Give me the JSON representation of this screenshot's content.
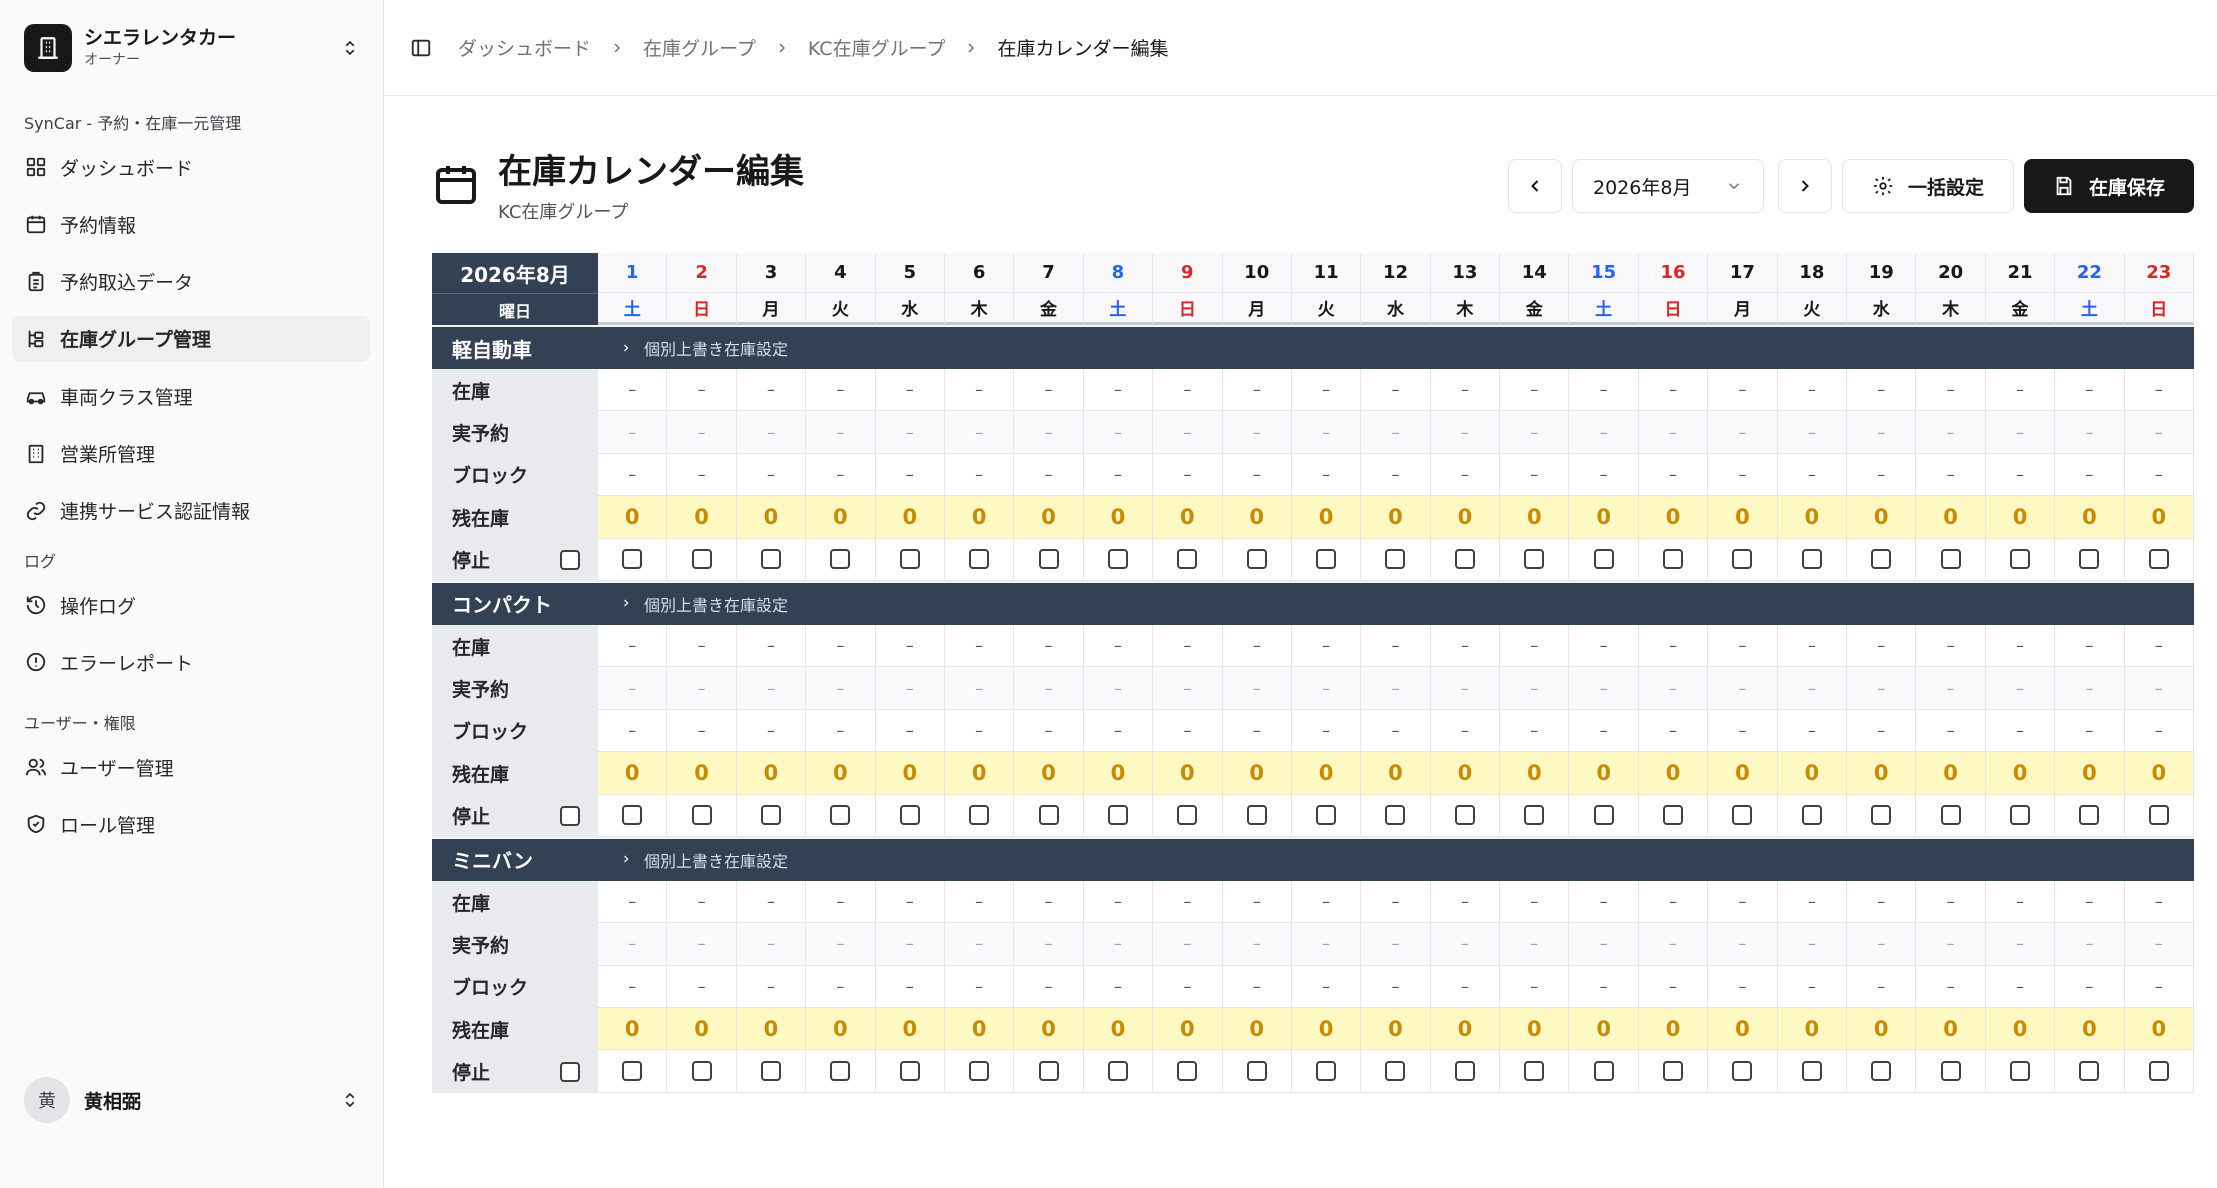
{
  "sidebar": {
    "org_name": "シエラレンタカー",
    "org_role": "オーナー",
    "section1": "SynCar - 予約・在庫一元管理",
    "items1": [
      {
        "label": "ダッシュボード",
        "icon": "grid-icon"
      },
      {
        "label": "予約情報",
        "icon": "calendar-icon"
      },
      {
        "label": "予約取込データ",
        "icon": "clipboard-icon"
      },
      {
        "label": "在庫グループ管理",
        "icon": "tree-icon",
        "active": true
      },
      {
        "label": "車両クラス管理",
        "icon": "car-icon"
      },
      {
        "label": "営業所管理",
        "icon": "building-icon"
      },
      {
        "label": "連携サービス認証情報",
        "icon": "link-icon"
      }
    ],
    "section2": "ログ",
    "items2": [
      {
        "label": "操作ログ",
        "icon": "history-icon"
      },
      {
        "label": "エラーレポート",
        "icon": "alert-icon"
      }
    ],
    "section3": "ユーザー・権限",
    "items3": [
      {
        "label": "ユーザー管理",
        "icon": "users-icon"
      },
      {
        "label": "ロール管理",
        "icon": "shield-icon"
      }
    ],
    "user_avatar": "黄",
    "user_name": "黄相弼"
  },
  "breadcrumb": [
    "ダッシュボード",
    "在庫グループ",
    "KC在庫グループ",
    "在庫カレンダー編集"
  ],
  "page": {
    "title": "在庫カレンダー編集",
    "subtitle": "KC在庫グループ",
    "month": "2026年8月",
    "bulk_label": "一括設定",
    "save_label": "在庫保存"
  },
  "calendar": {
    "month_label": "2026年8月",
    "weekday_label": "曜日",
    "days": [
      {
        "d": "1",
        "w": "土",
        "t": "sat"
      },
      {
        "d": "2",
        "w": "日",
        "t": "sun"
      },
      {
        "d": "3",
        "w": "月"
      },
      {
        "d": "4",
        "w": "火"
      },
      {
        "d": "5",
        "w": "水"
      },
      {
        "d": "6",
        "w": "木"
      },
      {
        "d": "7",
        "w": "金"
      },
      {
        "d": "8",
        "w": "土",
        "t": "sat"
      },
      {
        "d": "9",
        "w": "日",
        "t": "sun"
      },
      {
        "d": "10",
        "w": "月"
      },
      {
        "d": "11",
        "w": "火"
      },
      {
        "d": "12",
        "w": "水"
      },
      {
        "d": "13",
        "w": "木"
      },
      {
        "d": "14",
        "w": "金"
      },
      {
        "d": "15",
        "w": "土",
        "t": "sat"
      },
      {
        "d": "16",
        "w": "日",
        "t": "sun"
      },
      {
        "d": "17",
        "w": "月"
      },
      {
        "d": "18",
        "w": "火"
      },
      {
        "d": "19",
        "w": "水"
      },
      {
        "d": "20",
        "w": "木"
      },
      {
        "d": "21",
        "w": "金"
      },
      {
        "d": "22",
        "w": "土",
        "t": "sat"
      },
      {
        "d": "23",
        "w": "日",
        "t": "sun"
      }
    ],
    "override_label": "個別上書き在庫設定",
    "row_labels": {
      "stock": "在庫",
      "reserved": "実予約",
      "block": "ブロック",
      "remaining": "残在庫",
      "stop": "停止"
    },
    "empty_mark": "–",
    "groups": [
      {
        "name": "軽自動車",
        "remaining": [
          "0",
          "0",
          "0",
          "0",
          "0",
          "0",
          "0",
          "0",
          "0",
          "0",
          "0",
          "0",
          "0",
          "0",
          "0",
          "0",
          "0",
          "0",
          "0",
          "0",
          "0",
          "0",
          "0"
        ]
      },
      {
        "name": "コンパクト",
        "remaining": [
          "0",
          "0",
          "0",
          "0",
          "0",
          "0",
          "0",
          "0",
          "0",
          "0",
          "0",
          "0",
          "0",
          "0",
          "0",
          "0",
          "0",
          "0",
          "0",
          "0",
          "0",
          "0",
          "0"
        ]
      },
      {
        "name": "ミニバン",
        "remaining": [
          "0",
          "0",
          "0",
          "0",
          "0",
          "0",
          "0",
          "0",
          "0",
          "0",
          "0",
          "0",
          "0",
          "0",
          "0",
          "0",
          "0",
          "0",
          "0",
          "0",
          "0",
          "0",
          "0"
        ]
      }
    ]
  }
}
